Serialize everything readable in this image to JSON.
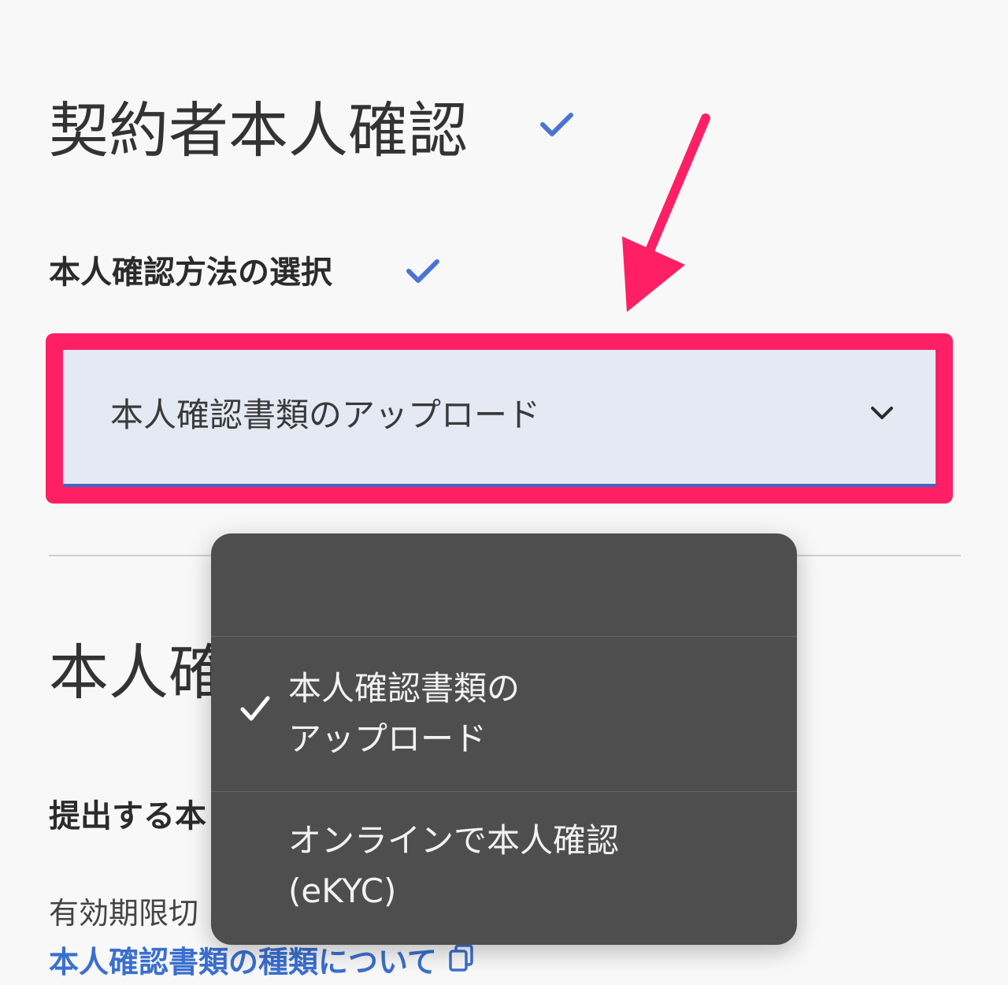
{
  "header": {
    "title": "契約者本人確認",
    "subtitle": "本人確認方法の選択"
  },
  "select": {
    "value": "本人確認書類のアップロード"
  },
  "menu": {
    "options": [
      {
        "line1": "本人確認書類の",
        "line2": "アップロード",
        "selected": true
      },
      {
        "line1": "オンラインで本人確認",
        "line2": "(eKYC)",
        "selected": false
      }
    ]
  },
  "section": {
    "title_visible": "本人確",
    "sub_visible": "提出する本",
    "note_visible": "有効期限切",
    "link": "本人確認書類の種類について"
  },
  "icons": {
    "title_check": "check-icon",
    "select_arrow": "chevron-down-icon",
    "menu_check": "checkmark-icon",
    "link_icon": "external-copy-icon",
    "annotation": "arrow-icon"
  },
  "colors": {
    "accent_blue": "#4068c6",
    "highlight": "#ff1f64",
    "menu_bg": "#4e4e4e",
    "link": "#3a6fd0"
  }
}
